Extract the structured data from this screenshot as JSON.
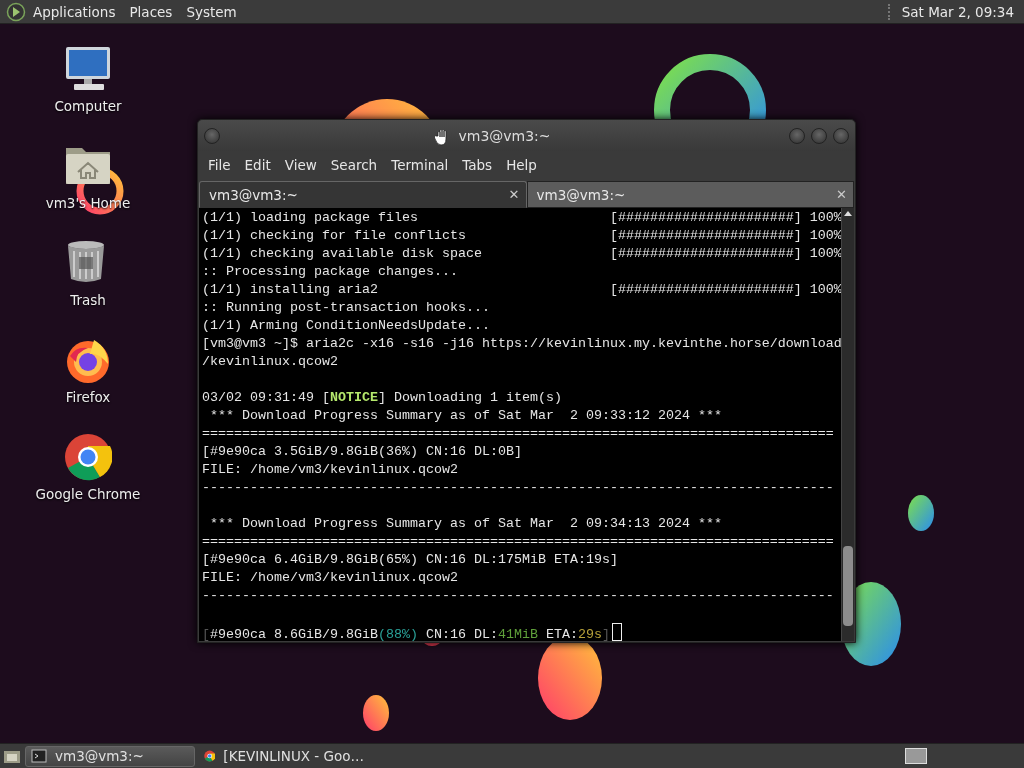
{
  "top_panel": {
    "menus": [
      "Applications",
      "Places",
      "System"
    ],
    "clock": "Sat Mar 2, 09:34"
  },
  "desktop_icons": [
    {
      "kind": "computer",
      "label": "Computer"
    },
    {
      "kind": "home",
      "label": "vm3's Home"
    },
    {
      "kind": "trash",
      "label": "Trash"
    },
    {
      "kind": "firefox",
      "label": "Firefox"
    },
    {
      "kind": "chrome",
      "label": "Google Chrome"
    }
  ],
  "terminal": {
    "title": "vm3@vm3:~",
    "menu": [
      "File",
      "Edit",
      "View",
      "Search",
      "Terminal",
      "Tabs",
      "Help"
    ],
    "tabs": [
      {
        "label": "vm3@vm3:~",
        "selected": true,
        "close": "✕"
      },
      {
        "label": "vm3@vm3:~",
        "selected": false,
        "close": "✕"
      }
    ],
    "lines": [
      {
        "kind": "text",
        "text": "(1/1) loading package files                        [######################] 100%"
      },
      {
        "kind": "text",
        "text": "(1/1) checking for file conflicts                  [######################] 100%"
      },
      {
        "kind": "text",
        "text": "(1/1) checking available disk space                [######################] 100%"
      },
      {
        "kind": "text",
        "text": ":: Processing package changes..."
      },
      {
        "kind": "text",
        "text": "(1/1) installing aria2                             [######################] 100%"
      },
      {
        "kind": "text",
        "text": ":: Running post-transaction hooks..."
      },
      {
        "kind": "text",
        "text": "(1/1) Arming ConditionNeedsUpdate..."
      },
      {
        "kind": "text",
        "text": "[vm3@vm3 ~]$ aria2c -x16 -s16 -j16 https://kevinlinux.my.kevinthe.horse/download"
      },
      {
        "kind": "text",
        "text": "/kevinlinux.qcow2"
      },
      {
        "kind": "blank"
      },
      {
        "kind": "spans",
        "spans": [
          {
            "text": "03/02 09:31:49 ["
          },
          {
            "text": "NOTICE",
            "color": "#b5e86c",
            "bold": true
          },
          {
            "text": "] Downloading 1 item(s)"
          }
        ]
      },
      {
        "kind": "text",
        "text": " *** Download Progress Summary as of Sat Mar  2 09:33:12 2024 ***"
      },
      {
        "kind": "text",
        "text": "==============================================================================="
      },
      {
        "kind": "text",
        "text": "[#9e90ca 3.5GiB/9.8GiB(36%) CN:16 DL:0B]"
      },
      {
        "kind": "text",
        "text": "FILE: /home/vm3/kevinlinux.qcow2"
      },
      {
        "kind": "text",
        "text": "-------------------------------------------------------------------------------"
      },
      {
        "kind": "blank"
      },
      {
        "kind": "text",
        "text": " *** Download Progress Summary as of Sat Mar  2 09:34:13 2024 ***"
      },
      {
        "kind": "text",
        "text": "==============================================================================="
      },
      {
        "kind": "text",
        "text": "[#9e90ca 6.4GiB/9.8GiB(65%) CN:16 DL:175MiB ETA:19s]"
      },
      {
        "kind": "text",
        "text": "FILE: /home/vm3/kevinlinux.qcow2"
      },
      {
        "kind": "text",
        "text": "-------------------------------------------------------------------------------"
      },
      {
        "kind": "blank"
      },
      {
        "kind": "spans",
        "cursor": true,
        "spans": [
          {
            "text": "[",
            "color": "#555555"
          },
          {
            "text": "#9e90ca 8.6GiB/9.8GiB"
          },
          {
            "text": "(88%)",
            "color": "#2aa198"
          },
          {
            "text": " CN:16 DL:"
          },
          {
            "text": "41MiB",
            "color": "#5fa03a"
          },
          {
            "text": " ETA:"
          },
          {
            "text": "29s",
            "color": "#b8a23a"
          },
          {
            "text": "]",
            "color": "#555555"
          }
        ]
      }
    ]
  },
  "taskbar": {
    "tasks": [
      {
        "kind": "terminal",
        "label": "vm3@vm3:~",
        "selected": true
      },
      {
        "kind": "chrome",
        "label": "[KEVINLINUX - Goo…",
        "selected": false
      }
    ]
  }
}
